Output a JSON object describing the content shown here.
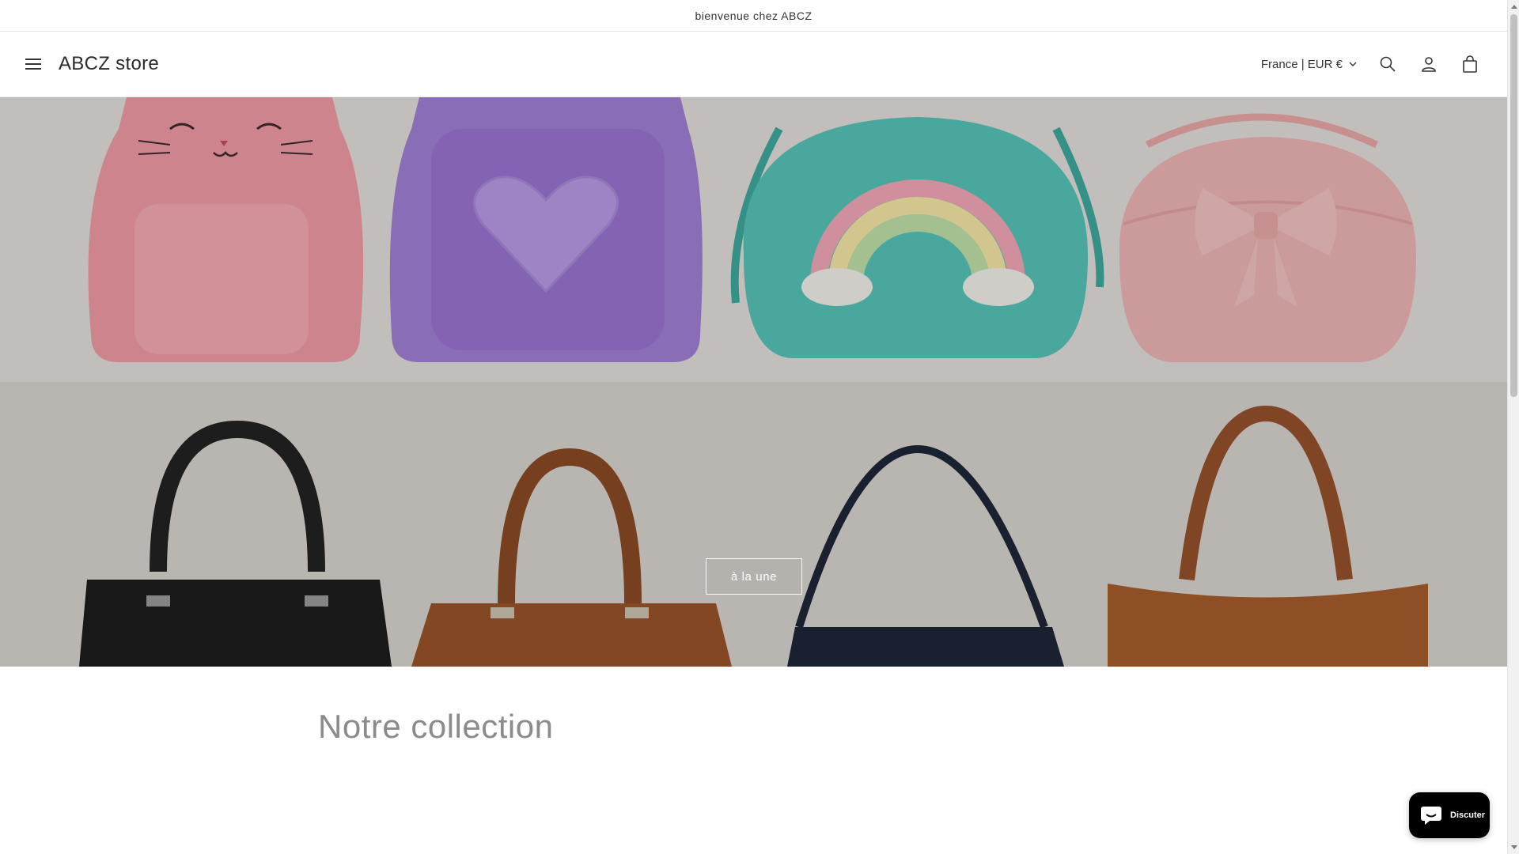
{
  "announcement": {
    "text": "bienvenue chez ABCZ"
  },
  "header": {
    "menu_icon": "hamburger-menu-icon",
    "brand": "ABCZ store",
    "locale": "France | EUR €",
    "icons": [
      "search-icon",
      "account-icon",
      "cart-icon"
    ]
  },
  "hero": {
    "cta_label": "à la une"
  },
  "collection": {
    "title": "Notre collection"
  },
  "chat": {
    "label": "Discuter",
    "icon": "chat-bubble-icon"
  },
  "colors": {
    "hero_bg": "#dcd7d3",
    "cat_pink": "#ef9aa4",
    "heart_purple": "#a07fd6",
    "teal": "#55c3b8",
    "bow_pink": "#edb4b4",
    "black_bag": "#1c1c1c",
    "brown_bag": "#9a532b",
    "navy_bag": "#1e2638",
    "tan_bag": "#a65c2c",
    "chat_bg": "#000000"
  }
}
